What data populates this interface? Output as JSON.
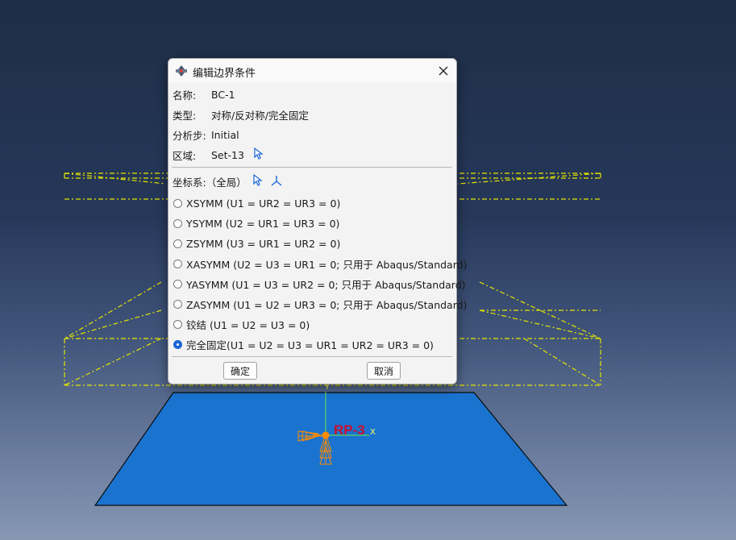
{
  "viewport": {
    "reference_point_label": "RP-3",
    "axis_x_label": "X",
    "axis_y_label": "Y"
  },
  "dialog": {
    "title": "编辑边界条件",
    "name_label": "名称:",
    "name_value": "BC-1",
    "type_label": "类型:",
    "type_value": "对称/反对称/完全固定",
    "step_label": "分析步:",
    "step_value": "Initial",
    "region_label": "区域:",
    "region_value": "Set-13",
    "csys_label": "坐标系:",
    "csys_value": "（全局）",
    "options": [
      {
        "label": "XSYMM (U1 = UR2 = UR3 = 0)",
        "selected": false
      },
      {
        "label": "YSYMM (U2 = UR1 = UR3 = 0)",
        "selected": false
      },
      {
        "label": "ZSYMM (U3 = UR1 = UR2 = 0)",
        "selected": false
      },
      {
        "label": "XASYMM (U2 = U3 = UR1 = 0; 只用于 Abaqus/Standard)",
        "selected": false
      },
      {
        "label": "YASYMM (U1 = U3 = UR2 = 0; 只用于 Abaqus/Standard)",
        "selected": false
      },
      {
        "label": "ZASYMM (U1 = U2 = UR3 = 0; 只用于 Abaqus/Standard)",
        "selected": false
      },
      {
        "label": "铰结 (U1 = U2 = U3 = 0)",
        "selected": false
      },
      {
        "label": "完全固定(U1 = U2 = U3 = UR1 = UR2 = UR3 = 0)",
        "selected": true
      }
    ],
    "ok_label": "确定",
    "cancel_label": "取消"
  },
  "colors": {
    "plate": "#1a73cf",
    "wireframe": "#e6e600",
    "rp_label": "#c8102e",
    "constraint_symbols": "#ff8c00",
    "radio_selected": "#1a66d6"
  }
}
